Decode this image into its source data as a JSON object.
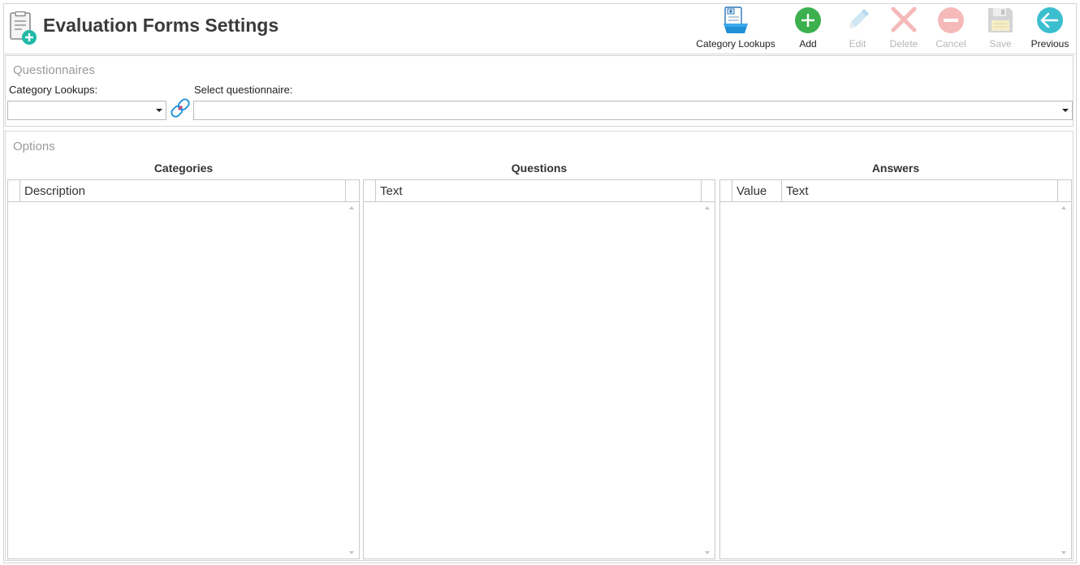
{
  "header": {
    "title": "Evaluation Forms Settings",
    "app_icon": "clipboard-add-icon"
  },
  "toolbar": {
    "category_lookups": {
      "label": "Category Lookups",
      "icon": "category-lookups-icon",
      "enabled": true
    },
    "add": {
      "label": "Add",
      "icon": "add-icon",
      "enabled": true,
      "color": "#3cb04e"
    },
    "edit": {
      "label": "Edit",
      "icon": "pencil-icon",
      "enabled": false
    },
    "delete": {
      "label": "Delete",
      "icon": "delete-x-icon",
      "enabled": false
    },
    "cancel": {
      "label": "Cancel",
      "icon": "cancel-icon",
      "enabled": false
    },
    "save": {
      "label": "Save",
      "icon": "save-icon",
      "enabled": false
    },
    "previous": {
      "label": "Previous",
      "icon": "back-arrow-icon",
      "enabled": true,
      "color": "#3bbfcf"
    }
  },
  "questionnaires": {
    "title": "Questionnaires",
    "category_lookups_label": "Category Lookups:",
    "category_lookups_value": "",
    "select_questionnaire_label": "Select questionnaire:",
    "select_questionnaire_value": ""
  },
  "options": {
    "title": "Options",
    "categories": {
      "title": "Categories",
      "columns": [
        "Description"
      ],
      "rows": []
    },
    "questions": {
      "title": "Questions",
      "columns": [
        "Text"
      ],
      "rows": []
    },
    "answers": {
      "title": "Answers",
      "columns": [
        "Value",
        "Text"
      ],
      "rows": []
    }
  }
}
